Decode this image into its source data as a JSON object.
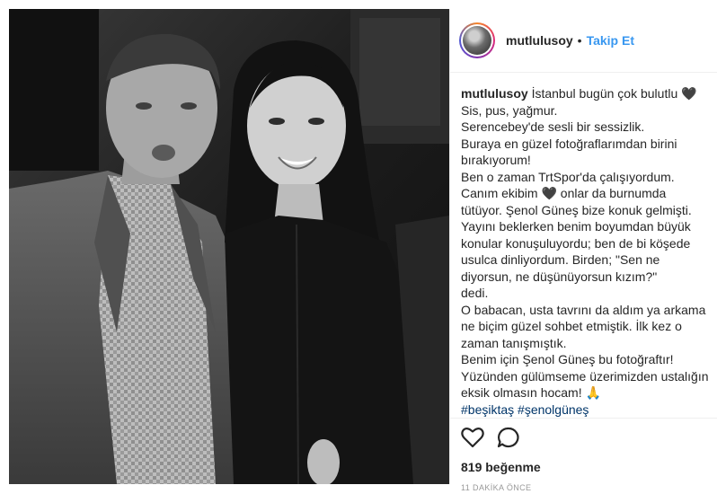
{
  "post": {
    "username": "mutlulusoy",
    "separator": "•",
    "follow_label": "Takip Et",
    "caption_lines": [
      "İstanbul bugün çok bulutlu 🖤",
      "Sis, pus, yağmur.",
      "Serencebey'de sesli bir sessizlik.",
      "Buraya en güzel fotoğraflarımdan birini",
      "bırakıyorum!",
      "Ben o zaman TrtSpor'da çalışıyordum.",
      "Canım ekibim 🖤 onlar da burnumda",
      "tütüyor. Şenol Güneş bize konuk gelmişti.",
      "Yayını beklerken benim boyumdan büyük",
      "konular konuşuluyordu; ben de bi köşede",
      "usulca dinliyordum. Birden; \"Sen ne",
      "diyorsun, ne düşünüyorsun kızım?\"",
      "dedi.",
      "O babacan, usta tavrını da aldım ya arkama",
      "ne biçim güzel sohbet etmiştik. İlk kez o",
      "zaman tanışmıştık.",
      "Benim için Şenol Güneş bu fotoğraftır!",
      "Yüzünden gülümseme üzerimizden ustalığın",
      "eksik olmasın hocam! 🙏"
    ],
    "hashtags": "#beşiktaş #şenolgüneş",
    "likes": "819 beğenme",
    "timestamp": "11 DAKİKA ÖNCE"
  },
  "icons": {
    "like": "heart-outline-icon",
    "comment": "speech-bubble-icon"
  }
}
